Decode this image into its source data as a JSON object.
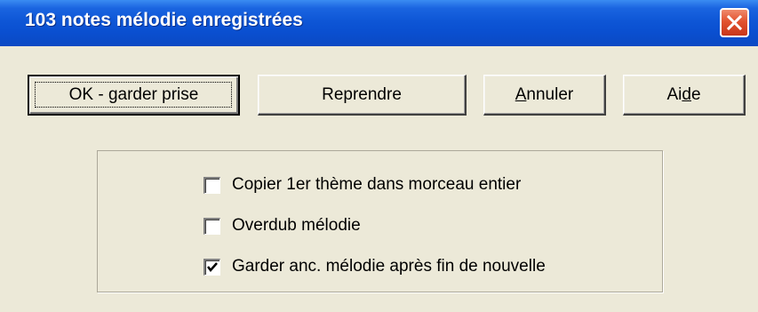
{
  "dialog": {
    "title": "103  notes mélodie enregistrées",
    "close_icon": "close-icon"
  },
  "buttons": {
    "ok_label": "OK - garder prise",
    "reprendre_label": "Reprendre",
    "annuler": {
      "mnemonic": "A",
      "rest": "nnuler"
    },
    "aide": {
      "before": "Ai",
      "mnemonic": "d",
      "after": "e"
    }
  },
  "options": [
    {
      "label": "Copier 1er thème dans morceau entier",
      "checked": false
    },
    {
      "label": "Overdub mélodie",
      "checked": false
    },
    {
      "label": "Garder anc. mélodie après fin de nouvelle",
      "checked": true
    }
  ],
  "colors": {
    "titlebar": "#0a4fd0",
    "dialog_bg": "#ece9d8",
    "close_button": "#e2532f"
  }
}
